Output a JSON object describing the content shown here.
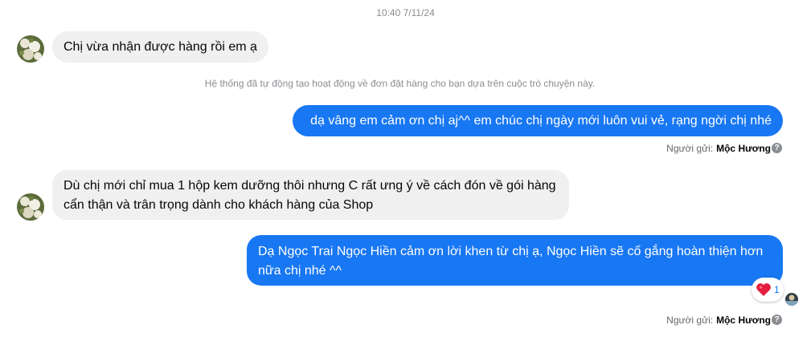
{
  "timestamp": "10:40 7/11/24",
  "system_note": "Hệ thống đã tự động tạo hoạt động về đơn đặt hàng cho bạn dựa trên cuộc trò chuyện này.",
  "messages": [
    {
      "direction": "incoming",
      "text": "Chị vừa nhận được hàng rồi em ạ"
    },
    {
      "direction": "outgoing",
      "text": "dạ vâng em cảm ơn chị aj^^ em chúc chị ngày mới luôn vui vẻ, rạng ngời chị nhé"
    },
    {
      "direction": "incoming",
      "text": "Dù chị mới chỉ mua 1 hộp kem dưỡng thôi nhưng C rất ưng ý về cách đón về gói hàng cẩn thận và trân trọng dành cho khách hàng của Shop"
    },
    {
      "direction": "outgoing",
      "text": "Dạ Ngọc Trai Ngọc Hiền cảm ơn lời khen từ chị ạ, Ngọc Hiền sẽ cố gắng hoàn thiện hơn nữa chị nhé ^^"
    }
  ],
  "sender_label": "Người gửi:",
  "sender_name": "Mộc Hương",
  "help_icon_glyph": "?",
  "reaction": {
    "icon": "heart-icon",
    "count": "1"
  },
  "colors": {
    "outgoing_bubble": "#1877f2",
    "incoming_bubble": "#f0f0f0",
    "reaction_heart": "#e41e3f"
  }
}
